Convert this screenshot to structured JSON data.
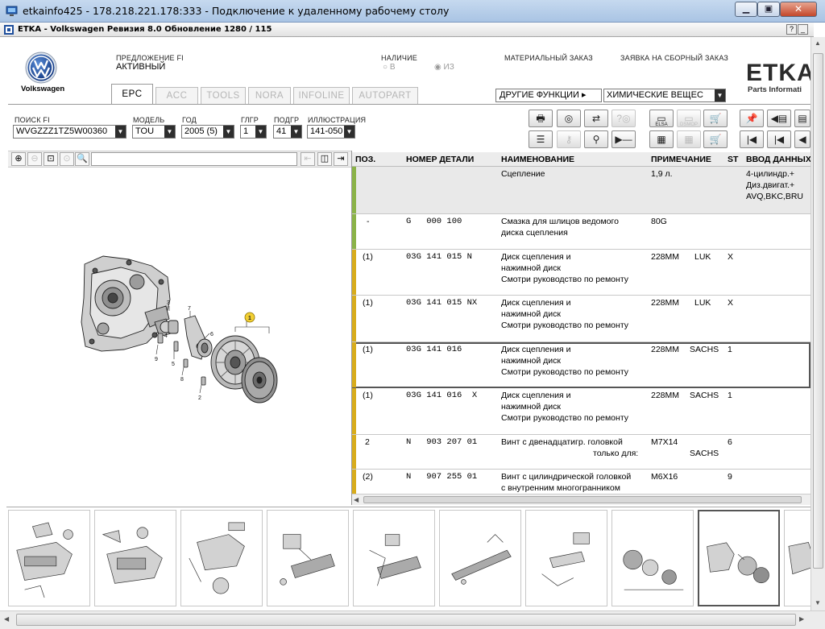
{
  "remote_window": {
    "title": "etkainfo425 - 178.218.221.178:333 - Подключение к удаленному рабочему столу",
    "minimize_label": "▁",
    "restore_label": "▣",
    "close_label": "✕"
  },
  "etka_window": {
    "title": "ETKA - Volkswagen Ревизия 8.0 Обновление 1280 / 115",
    "help_label": "?",
    "min_label": "_",
    "close_label": "x"
  },
  "brand": {
    "name": "Volkswagen",
    "etka_logo": "ETKA",
    "etka_sub": "Parts Informati"
  },
  "header": {
    "offer_label": "ПРЕДЛОЖЕНИЕ FI",
    "offer_value": "АКТИВНЫЙ",
    "stock_label": "НАЛИЧИЕ",
    "stock_opt_in": "В",
    "stock_opt_out": "ИЗ",
    "material_order": "МАТЕРИАЛЬНЫЙ ЗАКАЗ",
    "assembly_order": "ЗАЯВКА НА СБОРНЫЙ ЗАКАЗ",
    "other_functions": "ДРУГИЕ ФУНКЦИИ",
    "chemicals": "ХИМИЧЕСКИЕ ВЕЩЕС"
  },
  "tabs": [
    "EPC",
    "ACC",
    "TOOLS",
    "NORA",
    "INFOLINE",
    "AUTOPART"
  ],
  "search": {
    "fi_label": "ПОИСК FI",
    "fi_value": "WVGZZZ1TZ5W00360",
    "model_label": "МОДЕЛЬ",
    "model_value": "TOU",
    "year_label": "ГОД",
    "year_value": "2005 (5)",
    "mg_label": "ГЛГР",
    "mg_value": "1",
    "sg_label": "ПОДГР",
    "sg_value": "41",
    "illus_label": "ИЛЛЮСТРАЦИЯ",
    "illus_value": "141-050"
  },
  "toolbar_icons": {
    "elsa": "ELSA",
    "dsmop": "DSMOP"
  },
  "table": {
    "headers": {
      "pos": "ПОЗ.",
      "part_no": "НОМЕР ДЕТАЛИ",
      "name": "НАИМЕНОВАНИЕ",
      "note": "ПРИМЕЧАНИЕ",
      "st": "ST",
      "data": "ВВОД ДАННЫХ"
    },
    "rows": [
      {
        "pos": "",
        "part": "",
        "name": [
          "Сцепление"
        ],
        "note": "1,9 л.",
        "brand": "",
        "st": "",
        "data": [
          "4-цилиндр.+",
          "Диз.двигат.+",
          "AVQ,BKC,BRU"
        ]
      },
      {
        "pos": "-",
        "part": "G   000 100",
        "name": [
          "Смазка для шлицов ведомого",
          "диска сцепления"
        ],
        "note": "80G",
        "brand": "",
        "st": "",
        "data": []
      },
      {
        "pos": "(1)",
        "part": "03G 141 015 N",
        "name": [
          "Диск сцепления и",
          "нажимной диск",
          "Смотри руководство по ремонту"
        ],
        "note": "228MM",
        "brand": "LUK",
        "st": "X",
        "data": []
      },
      {
        "pos": "(1)",
        "part": "03G 141 015 NX",
        "name": [
          "Диск сцепления и",
          "нажимной диск",
          "Смотри руководство по ремонту"
        ],
        "note": "228MM",
        "brand": "LUK",
        "st": "X",
        "data": []
      },
      {
        "pos": "(1)",
        "part": "03G 141 016",
        "name": [
          "Диск сцепления и",
          "нажимной диск",
          "Смотри руководство по ремонту"
        ],
        "note": "228MM",
        "brand": "SACHS",
        "st": "1",
        "data": []
      },
      {
        "pos": "(1)",
        "part": "03G 141 016  X",
        "name": [
          "Диск сцепления и",
          "нажимной диск",
          "Смотри руководство по ремонту"
        ],
        "note": "228MM",
        "brand": "SACHS",
        "st": "1",
        "data": []
      },
      {
        "pos": "2",
        "part": "N   903 207 01",
        "name": [
          "Винт с двенадцатигр. головкой",
          "только для:"
        ],
        "note": "M7X14",
        "brand": "SACHS",
        "st": "6",
        "data": []
      },
      {
        "pos": "(2)",
        "part": "N   907 255 01",
        "name": [
          "Винт с цилиндрической головкой",
          "с внутренним многогранником"
        ],
        "note": "M6X16",
        "brand": "",
        "st": "9",
        "data": []
      }
    ]
  },
  "diagram": {
    "callout": "1",
    "labels": [
      "3",
      "7",
      "4",
      "9",
      "5",
      "8",
      "6",
      "2"
    ]
  },
  "colors": {
    "bar_green": "#8bb348",
    "bar_yellow": "#d8ac1c",
    "callout_yellow": "#f2cf33"
  }
}
